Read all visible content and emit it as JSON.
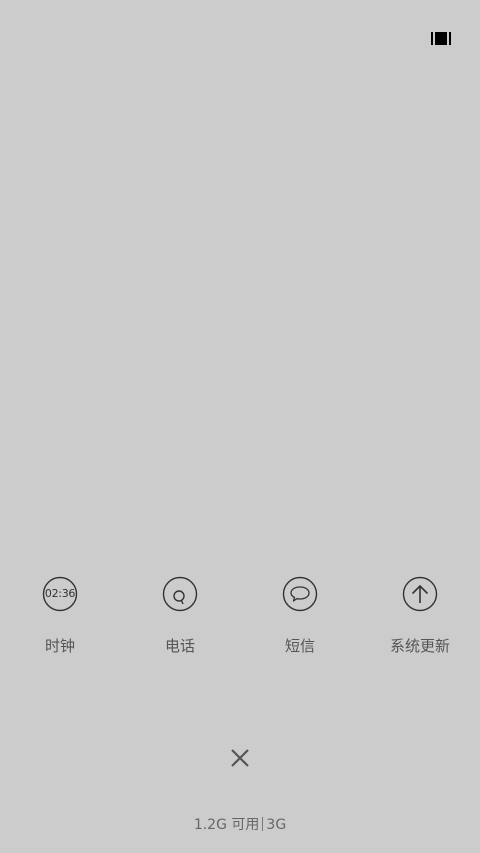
{
  "top_bar": {
    "icon": "recents-view-icon"
  },
  "apps": [
    {
      "label": "时钟",
      "icon": "clock-icon",
      "clock_time": "02:36"
    },
    {
      "label": "电话",
      "icon": "phone-icon"
    },
    {
      "label": "短信",
      "icon": "message-icon"
    },
    {
      "label": "系统更新",
      "icon": "update-arrow-icon"
    }
  ],
  "close_icon": "close-icon",
  "memory": {
    "available": "1.2G 可用",
    "total": "3G"
  }
}
